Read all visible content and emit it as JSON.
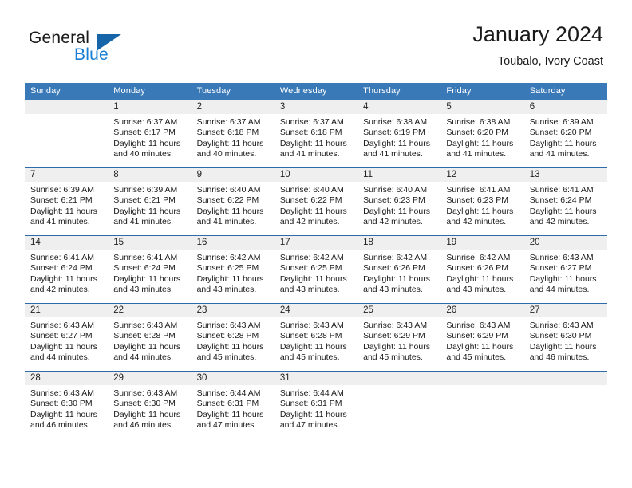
{
  "logo": {
    "line1": "General",
    "line2": "Blue",
    "icon": "triangle-icon",
    "color_dark": "#1a1a1a",
    "color_blue": "#1a7fd4",
    "color_triangle": "#1565a8"
  },
  "header": {
    "title": "January 2024",
    "subtitle": "Toubalo, Ivory Coast"
  },
  "colors": {
    "header_bg": "#3a79b8",
    "header_text": "#ffffff",
    "row_divider": "#2c6cab",
    "daynum_band": "#efefef",
    "cell_bg": "#ffffff"
  },
  "weekday_headers": [
    "Sunday",
    "Monday",
    "Tuesday",
    "Wednesday",
    "Thursday",
    "Friday",
    "Saturday"
  ],
  "weeks": [
    [
      {
        "day": "",
        "lines": []
      },
      {
        "day": "1",
        "lines": [
          "Sunrise: 6:37 AM",
          "Sunset: 6:17 PM",
          "Daylight: 11 hours",
          "and 40 minutes."
        ]
      },
      {
        "day": "2",
        "lines": [
          "Sunrise: 6:37 AM",
          "Sunset: 6:18 PM",
          "Daylight: 11 hours",
          "and 40 minutes."
        ]
      },
      {
        "day": "3",
        "lines": [
          "Sunrise: 6:37 AM",
          "Sunset: 6:18 PM",
          "Daylight: 11 hours",
          "and 41 minutes."
        ]
      },
      {
        "day": "4",
        "lines": [
          "Sunrise: 6:38 AM",
          "Sunset: 6:19 PM",
          "Daylight: 11 hours",
          "and 41 minutes."
        ]
      },
      {
        "day": "5",
        "lines": [
          "Sunrise: 6:38 AM",
          "Sunset: 6:20 PM",
          "Daylight: 11 hours",
          "and 41 minutes."
        ]
      },
      {
        "day": "6",
        "lines": [
          "Sunrise: 6:39 AM",
          "Sunset: 6:20 PM",
          "Daylight: 11 hours",
          "and 41 minutes."
        ]
      }
    ],
    [
      {
        "day": "7",
        "lines": [
          "Sunrise: 6:39 AM",
          "Sunset: 6:21 PM",
          "Daylight: 11 hours",
          "and 41 minutes."
        ]
      },
      {
        "day": "8",
        "lines": [
          "Sunrise: 6:39 AM",
          "Sunset: 6:21 PM",
          "Daylight: 11 hours",
          "and 41 minutes."
        ]
      },
      {
        "day": "9",
        "lines": [
          "Sunrise: 6:40 AM",
          "Sunset: 6:22 PM",
          "Daylight: 11 hours",
          "and 41 minutes."
        ]
      },
      {
        "day": "10",
        "lines": [
          "Sunrise: 6:40 AM",
          "Sunset: 6:22 PM",
          "Daylight: 11 hours",
          "and 42 minutes."
        ]
      },
      {
        "day": "11",
        "lines": [
          "Sunrise: 6:40 AM",
          "Sunset: 6:23 PM",
          "Daylight: 11 hours",
          "and 42 minutes."
        ]
      },
      {
        "day": "12",
        "lines": [
          "Sunrise: 6:41 AM",
          "Sunset: 6:23 PM",
          "Daylight: 11 hours",
          "and 42 minutes."
        ]
      },
      {
        "day": "13",
        "lines": [
          "Sunrise: 6:41 AM",
          "Sunset: 6:24 PM",
          "Daylight: 11 hours",
          "and 42 minutes."
        ]
      }
    ],
    [
      {
        "day": "14",
        "lines": [
          "Sunrise: 6:41 AM",
          "Sunset: 6:24 PM",
          "Daylight: 11 hours",
          "and 42 minutes."
        ]
      },
      {
        "day": "15",
        "lines": [
          "Sunrise: 6:41 AM",
          "Sunset: 6:24 PM",
          "Daylight: 11 hours",
          "and 43 minutes."
        ]
      },
      {
        "day": "16",
        "lines": [
          "Sunrise: 6:42 AM",
          "Sunset: 6:25 PM",
          "Daylight: 11 hours",
          "and 43 minutes."
        ]
      },
      {
        "day": "17",
        "lines": [
          "Sunrise: 6:42 AM",
          "Sunset: 6:25 PM",
          "Daylight: 11 hours",
          "and 43 minutes."
        ]
      },
      {
        "day": "18",
        "lines": [
          "Sunrise: 6:42 AM",
          "Sunset: 6:26 PM",
          "Daylight: 11 hours",
          "and 43 minutes."
        ]
      },
      {
        "day": "19",
        "lines": [
          "Sunrise: 6:42 AM",
          "Sunset: 6:26 PM",
          "Daylight: 11 hours",
          "and 43 minutes."
        ]
      },
      {
        "day": "20",
        "lines": [
          "Sunrise: 6:43 AM",
          "Sunset: 6:27 PM",
          "Daylight: 11 hours",
          "and 44 minutes."
        ]
      }
    ],
    [
      {
        "day": "21",
        "lines": [
          "Sunrise: 6:43 AM",
          "Sunset: 6:27 PM",
          "Daylight: 11 hours",
          "and 44 minutes."
        ]
      },
      {
        "day": "22",
        "lines": [
          "Sunrise: 6:43 AM",
          "Sunset: 6:28 PM",
          "Daylight: 11 hours",
          "and 44 minutes."
        ]
      },
      {
        "day": "23",
        "lines": [
          "Sunrise: 6:43 AM",
          "Sunset: 6:28 PM",
          "Daylight: 11 hours",
          "and 45 minutes."
        ]
      },
      {
        "day": "24",
        "lines": [
          "Sunrise: 6:43 AM",
          "Sunset: 6:28 PM",
          "Daylight: 11 hours",
          "and 45 minutes."
        ]
      },
      {
        "day": "25",
        "lines": [
          "Sunrise: 6:43 AM",
          "Sunset: 6:29 PM",
          "Daylight: 11 hours",
          "and 45 minutes."
        ]
      },
      {
        "day": "26",
        "lines": [
          "Sunrise: 6:43 AM",
          "Sunset: 6:29 PM",
          "Daylight: 11 hours",
          "and 45 minutes."
        ]
      },
      {
        "day": "27",
        "lines": [
          "Sunrise: 6:43 AM",
          "Sunset: 6:30 PM",
          "Daylight: 11 hours",
          "and 46 minutes."
        ]
      }
    ],
    [
      {
        "day": "28",
        "lines": [
          "Sunrise: 6:43 AM",
          "Sunset: 6:30 PM",
          "Daylight: 11 hours",
          "and 46 minutes."
        ]
      },
      {
        "day": "29",
        "lines": [
          "Sunrise: 6:43 AM",
          "Sunset: 6:30 PM",
          "Daylight: 11 hours",
          "and 46 minutes."
        ]
      },
      {
        "day": "30",
        "lines": [
          "Sunrise: 6:44 AM",
          "Sunset: 6:31 PM",
          "Daylight: 11 hours",
          "and 47 minutes."
        ]
      },
      {
        "day": "31",
        "lines": [
          "Sunrise: 6:44 AM",
          "Sunset: 6:31 PM",
          "Daylight: 11 hours",
          "and 47 minutes."
        ]
      },
      {
        "day": "",
        "lines": []
      },
      {
        "day": "",
        "lines": []
      },
      {
        "day": "",
        "lines": []
      }
    ]
  ]
}
